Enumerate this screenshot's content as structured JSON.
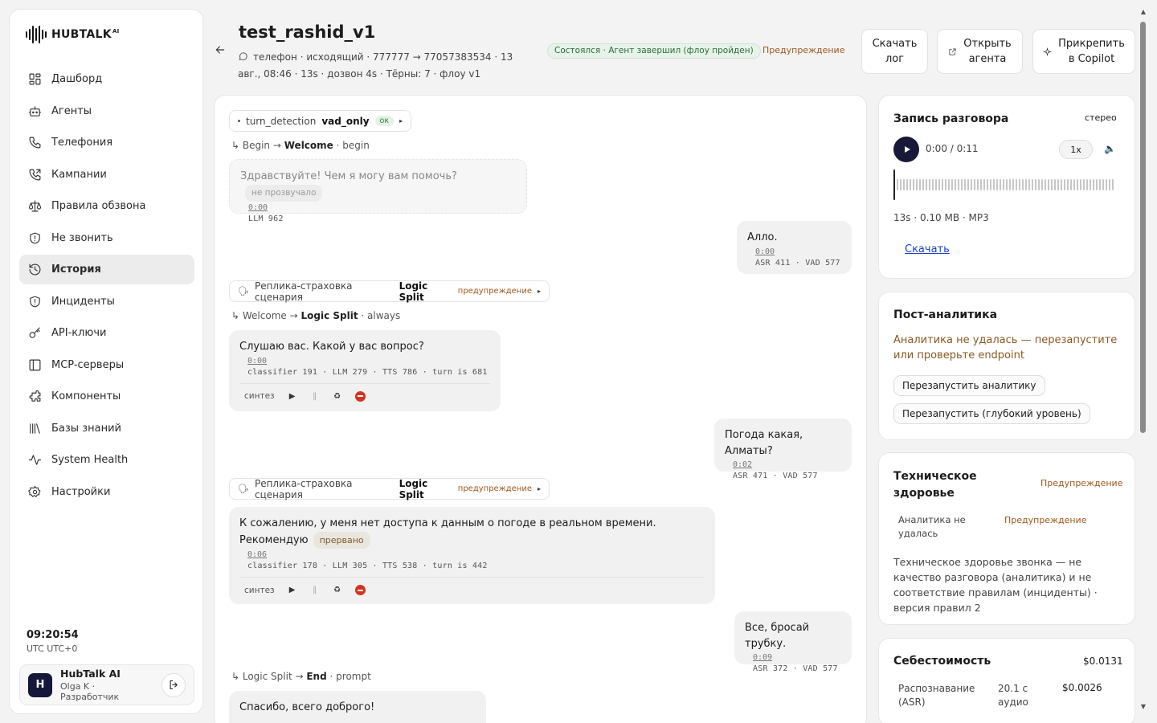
{
  "sidebar": {
    "logo_text": "HUBTALK",
    "logo_sup": "AI",
    "items": [
      {
        "label": "Дашборд",
        "icon": "dashboard-icon"
      },
      {
        "label": "Агенты",
        "icon": "robot-icon"
      },
      {
        "label": "Телефония",
        "icon": "phone-icon"
      },
      {
        "label": "Кампании",
        "icon": "phone-outgoing-icon"
      },
      {
        "label": "Правила обзвона",
        "icon": "scale-icon"
      },
      {
        "label": "Не звонить",
        "icon": "shield-icon"
      },
      {
        "label": "История",
        "icon": "history-icon",
        "active": true
      },
      {
        "label": "Инциденты",
        "icon": "shield-alert-icon"
      },
      {
        "label": "API-ключи",
        "icon": "key-icon"
      },
      {
        "label": "MCP-серверы",
        "icon": "server-icon"
      },
      {
        "label": "Компоненты",
        "icon": "puzzle-icon"
      },
      {
        "label": "Базы знаний",
        "icon": "library-icon"
      },
      {
        "label": "System Health",
        "icon": "activity-icon"
      },
      {
        "label": "Настройки",
        "icon": "gear-icon"
      }
    ],
    "clock_time": "09:20:54",
    "clock_tz": "UTC UTC+0",
    "user": {
      "initial": "H",
      "name": "HubTalk AI",
      "role": "Olga K · Разработчик"
    }
  },
  "header": {
    "title": "test_rashid_v1",
    "meta_channel": "телефон",
    "meta_line": "· исходящий · 777777 → 77057383534 · 13 авг., 08:46 · 13s · дозвон 4s · Тёрны: 7 · флоу v1",
    "status_badge": "Состоялся · Агент завершил (флоу пройден)",
    "warning_link": "Предупреждение",
    "buttons": {
      "download_log_1": "Скачать",
      "download_log_2": "лог",
      "open_agent_1": "Открыть",
      "open_agent_2": "агента",
      "copilot_1": "Прикрепить",
      "copilot_2": "в Copilot"
    }
  },
  "transcript": {
    "turn_detection": {
      "label": "turn_detection",
      "value": "vad_only",
      "tag": "ок"
    },
    "flow1": {
      "from": "↳ Begin →",
      "to": "Welcome",
      "suffix": "· begin"
    },
    "bot1": {
      "text": "Здравствуйте! Чем я могу вам помочь?",
      "tag": "не прозвучало",
      "ts": "0:00",
      "metrics": "LLM 962"
    },
    "user1": {
      "text": "Алло.",
      "ts": "0:00",
      "metrics": "ASR 411 · VAD 577"
    },
    "split1": {
      "label": "Реплика-страховка сценария",
      "value": "Logic Split",
      "tag": "предупреждение"
    },
    "flow2": {
      "from": "↳ Welcome →",
      "to": "Logic Split",
      "suffix": "· always"
    },
    "bot2": {
      "text": "Слушаю вас. Какой у вас вопрос?",
      "ts": "0:00",
      "metrics": "classifier 191 · LLM 279 · TTS 786 · turn is 681",
      "synth": "синтез"
    },
    "user2": {
      "text": "Погода какая, Алматы?",
      "ts": "0:02",
      "metrics": "ASR 471 · VAD 577"
    },
    "split2": {
      "label": "Реплика-страховка сценария",
      "value": "Logic Split",
      "tag": "предупреждение"
    },
    "bot3": {
      "text1": "К сожалению, у меня нет доступа к данным о погоде в реальном времени.",
      "text2": "Рекомендую",
      "tag": "прервано",
      "ts": "0:06",
      "metrics": "classifier 178 · LLM 305 · TTS 538 · turn is 442",
      "synth": "синтез"
    },
    "user3": {
      "text": "Все, бросай трубку.",
      "ts": "0:09",
      "metrics": "ASR 372 · VAD 577"
    },
    "flow3": {
      "from": "↳ Logic Split →",
      "to": "End",
      "suffix": "· prompt"
    },
    "bot4": {
      "text": "Спасибо, всего доброго!"
    }
  },
  "recording": {
    "title": "Запись разговора",
    "mode": "стерео",
    "time": "0:00 / 0:11",
    "speed": "1x",
    "info": "13s · 0.10 MB · MP3",
    "download": "Скачать",
    "progress": 0
  },
  "post_analytics": {
    "title": "Пост-аналитика",
    "error": "Аналитика не удалась — перезапустите или проверьте endpoint",
    "btn_restart": "Перезапустить аналитику",
    "btn_deep": "Перезапустить (глубокий уровень)"
  },
  "tech_health": {
    "title_1": "Техническое",
    "title_2": "здоровье",
    "status": "Предупреждение",
    "row_label_1": "Аналитика не",
    "row_label_2": "удалась",
    "row_status": "Предупреждение",
    "description": "Техническое здоровье звонка — не качество разговора (аналитика) и не соответствие правилам (инциденты) · версия правил 2"
  },
  "cost": {
    "title": "Себестоимость",
    "total": "$0.0131",
    "row_label_1": "Распознавание",
    "row_label_2": "(ASR)",
    "row_amount_1": "20.1 с",
    "row_amount_2": "аудио",
    "row_cost": "$0.0026"
  },
  "colors": {
    "accent": "#181838",
    "warning": "#a0571d",
    "success_bg": "#e6f3e9",
    "danger": "#d5331f"
  }
}
